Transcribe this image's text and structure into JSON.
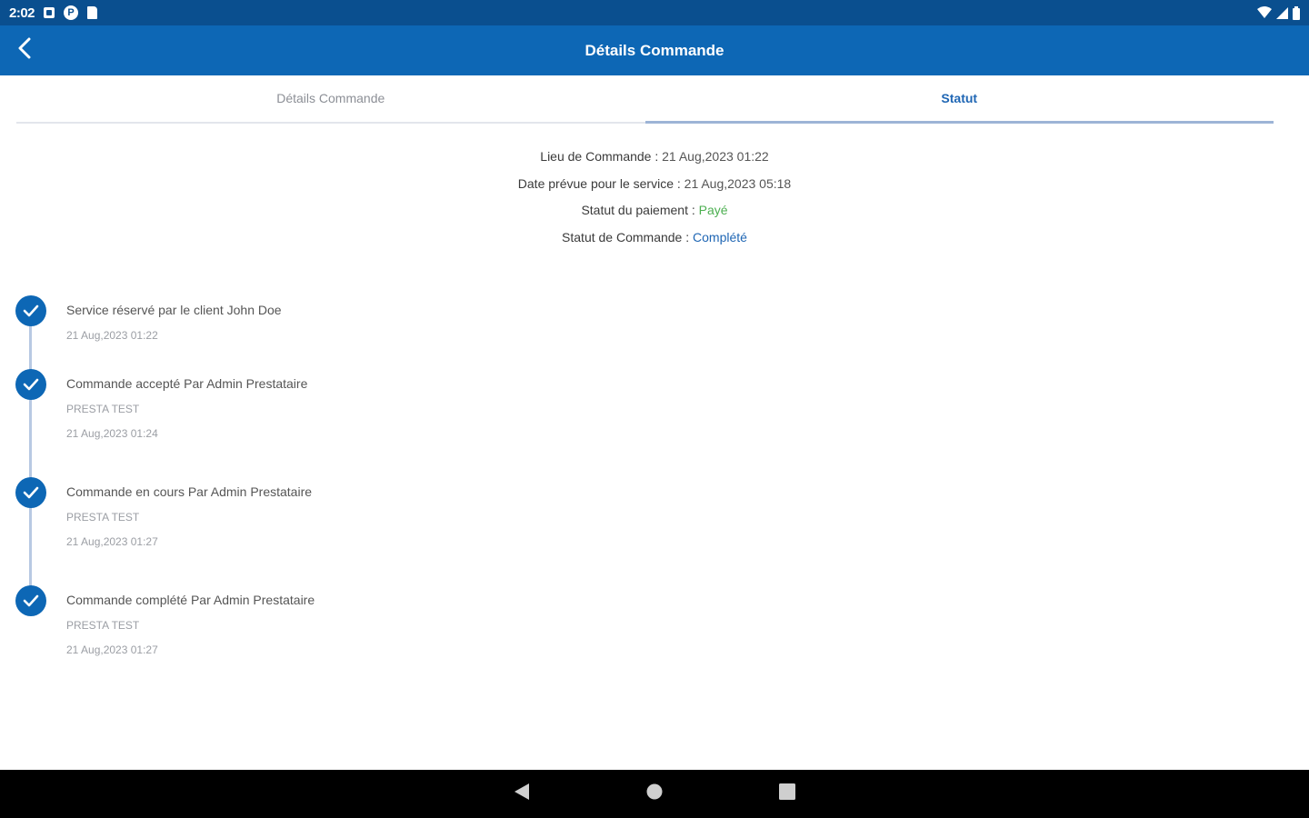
{
  "status_bar": {
    "time": "2:02",
    "icons": [
      "notification-square-icon",
      "p-badge-icon",
      "sd-card-icon"
    ],
    "right_icons": [
      "wifi-icon",
      "cellular-signal-icon",
      "battery-icon"
    ]
  },
  "app_bar": {
    "title": "Détails Commande",
    "back_icon": "chevron-left-icon"
  },
  "tabs": [
    {
      "label": "Détails Commande",
      "active": false
    },
    {
      "label": "Statut",
      "active": true
    }
  ],
  "summary": {
    "order_place_label": "Lieu de Commande :",
    "order_place_value": "21 Aug,2023 01:22",
    "service_date_label": "Date prévue pour le service :",
    "service_date_value": "21 Aug,2023 05:18",
    "payment_status_label": "Statut du paiement :",
    "payment_status_value": "Payé",
    "order_status_label": "Statut de Commande :",
    "order_status_value": "Complété"
  },
  "timeline": [
    {
      "title": "Service réservé par le client John Doe",
      "provider": "",
      "date": "21 Aug,2023 01:22"
    },
    {
      "title": "Commande accepté Par Admin Prestataire",
      "provider": "PRESTA TEST",
      "date": "21 Aug,2023 01:24"
    },
    {
      "title": "Commande en cours Par Admin Prestataire",
      "provider": "PRESTA TEST",
      "date": "21 Aug,2023 01:27"
    },
    {
      "title": "Commande complété Par Admin Prestataire",
      "provider": "PRESTA TEST",
      "date": "21 Aug,2023 01:27"
    }
  ],
  "colors": {
    "status_bar": "#0a4f8f",
    "app_bar": "#0d67b5",
    "active_tab": "#1f66b4",
    "paid": "#4caf50",
    "completed": "#1f66b4"
  },
  "nav_bar": {
    "icons": [
      "back-triangle-icon",
      "home-circle-icon",
      "recents-square-icon"
    ]
  }
}
